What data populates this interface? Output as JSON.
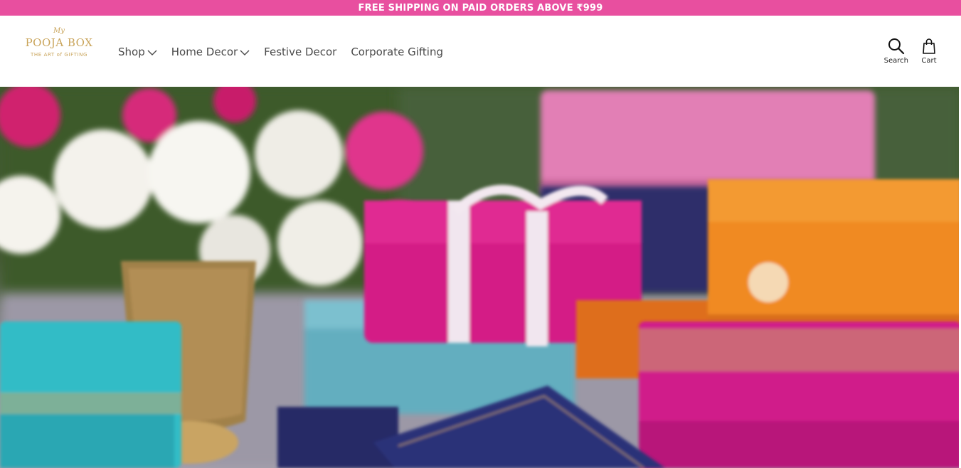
{
  "announcement": {
    "text": "FREE SHIPPING ON PAID ORDERS ABOVE ₹999"
  },
  "logo": {
    "prefix": "My",
    "name": "POOJA BOX",
    "tagline": "THE ART of GIFTING"
  },
  "nav": {
    "items": [
      {
        "label": "Shop",
        "has_dropdown": true
      },
      {
        "label": "Home Decor",
        "has_dropdown": true
      },
      {
        "label": "Festive Decor",
        "has_dropdown": false
      },
      {
        "label": "Corporate Gifting",
        "has_dropdown": false
      }
    ]
  },
  "actions": {
    "search_label": "Search",
    "search_icon": "search-icon",
    "cart_label": "Cart",
    "cart_icon": "cart-icon"
  },
  "colors": {
    "announcement_bg": "#e84f9f",
    "logo_gold": "#c9a45a",
    "nav_text": "#4a4a4a"
  }
}
